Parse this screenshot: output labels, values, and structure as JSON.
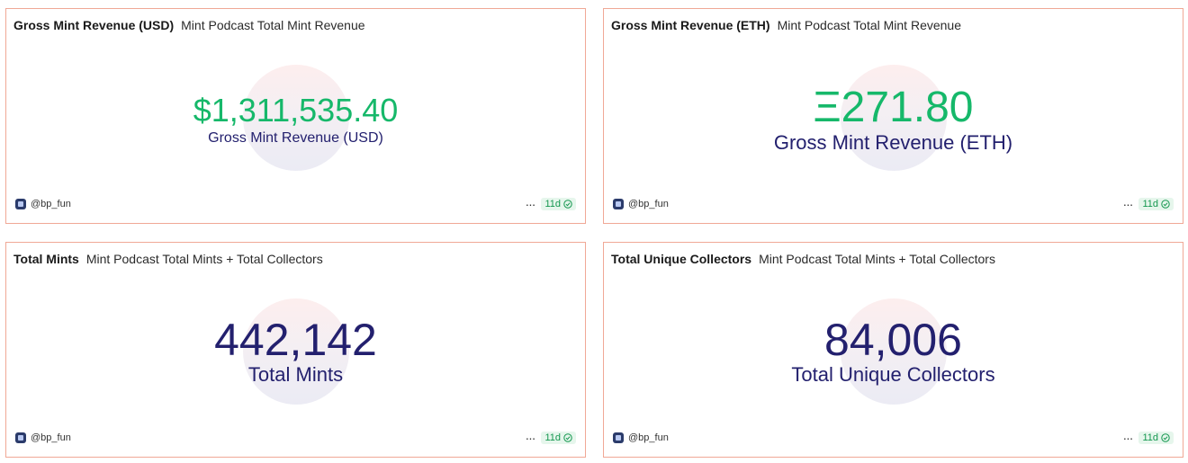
{
  "cards": [
    {
      "title": "Gross Mint Revenue (USD)",
      "subtitle": "Mint Podcast Total Mint Revenue",
      "value": "$1,311,535.40",
      "label": "Gross Mint Revenue (USD)",
      "owner": "@bp_fun",
      "more": "···",
      "age": "11d"
    },
    {
      "title": "Gross Mint Revenue (ETH)",
      "subtitle": "Mint Podcast Total Mint Revenue",
      "value": "Ξ271.80",
      "label": "Gross Mint Revenue (ETH)",
      "owner": "@bp_fun",
      "more": "···",
      "age": "11d"
    },
    {
      "title": "Total Mints",
      "subtitle": "Mint Podcast Total Mints + Total Collectors",
      "value": "442,142",
      "label": "Total Mints",
      "owner": "@bp_fun",
      "more": "···",
      "age": "11d"
    },
    {
      "title": "Total Unique Collectors",
      "subtitle": "Mint Podcast Total Mints + Total Collectors",
      "value": "84,006",
      "label": "Total Unique Collectors",
      "owner": "@bp_fun",
      "more": "···",
      "age": "11d"
    }
  ],
  "colors": {
    "positive_value": "#16b86a",
    "neutral_value": "#23206e",
    "card_border": "#f0a896",
    "badge_bg": "#e6f6ec",
    "badge_text": "#14974f"
  },
  "icons": {
    "owner": "user-avatar-icon",
    "more": "more-options-icon",
    "status": "check-circle-icon"
  }
}
